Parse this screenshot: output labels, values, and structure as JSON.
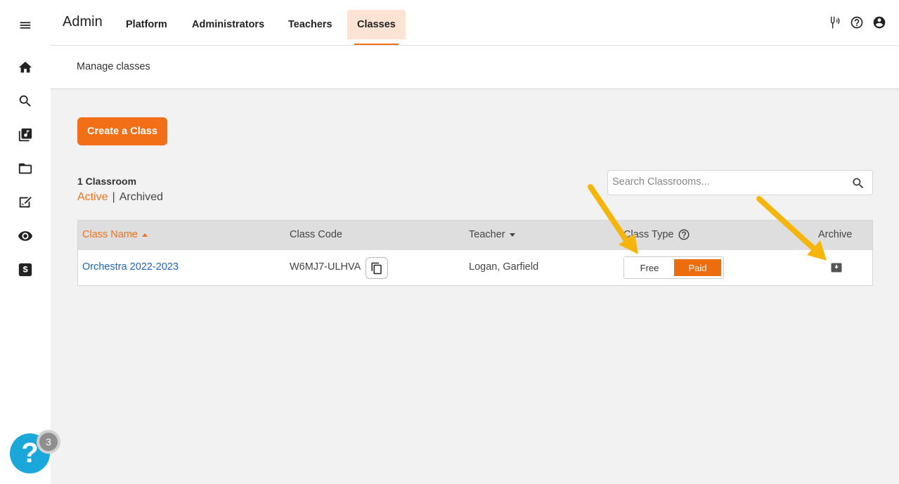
{
  "header": {
    "brand": "Admin",
    "tabs": [
      {
        "label": "Platform"
      },
      {
        "label": "Administrators"
      },
      {
        "label": "Teachers"
      },
      {
        "label": "Classes",
        "active": true
      }
    ],
    "icons": [
      "tuning-fork-icon",
      "help-circle-icon",
      "account-circle-icon"
    ]
  },
  "sidebar": {
    "icons": [
      "menu-icon",
      "home-icon",
      "search-icon",
      "music-library-icon",
      "folder-icon",
      "assignment-icon",
      "eye-icon",
      "s-logo-icon"
    ]
  },
  "subheader": {
    "title": "Manage classes"
  },
  "main": {
    "create_button": "Create a Class",
    "count_label": "1 Classroom",
    "filters": {
      "active": "Active",
      "separator": "|",
      "archived": "Archived"
    },
    "search": {
      "placeholder": "Search Classrooms..."
    },
    "table": {
      "columns": [
        {
          "label": "Class Name",
          "sort": "asc"
        },
        {
          "label": "Class Code"
        },
        {
          "label": "Teacher",
          "sort": "desc"
        },
        {
          "label": "Class Type"
        },
        {
          "label": "Archive"
        }
      ],
      "rows": [
        {
          "class_name": "Orchestra 2022-2023",
          "class_code": "W6MJ7-ULHVA",
          "teacher": "Logan, Garfield",
          "class_type_options": [
            "Free",
            "Paid"
          ],
          "class_type_selected": "Paid"
        }
      ]
    }
  },
  "help_widget": {
    "glyph": "?",
    "badge_count": "3"
  },
  "colors": {
    "accent": "#f26f17",
    "link": "#1e62b5",
    "help_bubble": "#1aa8db",
    "annotation_arrow": "#f5b50a"
  }
}
